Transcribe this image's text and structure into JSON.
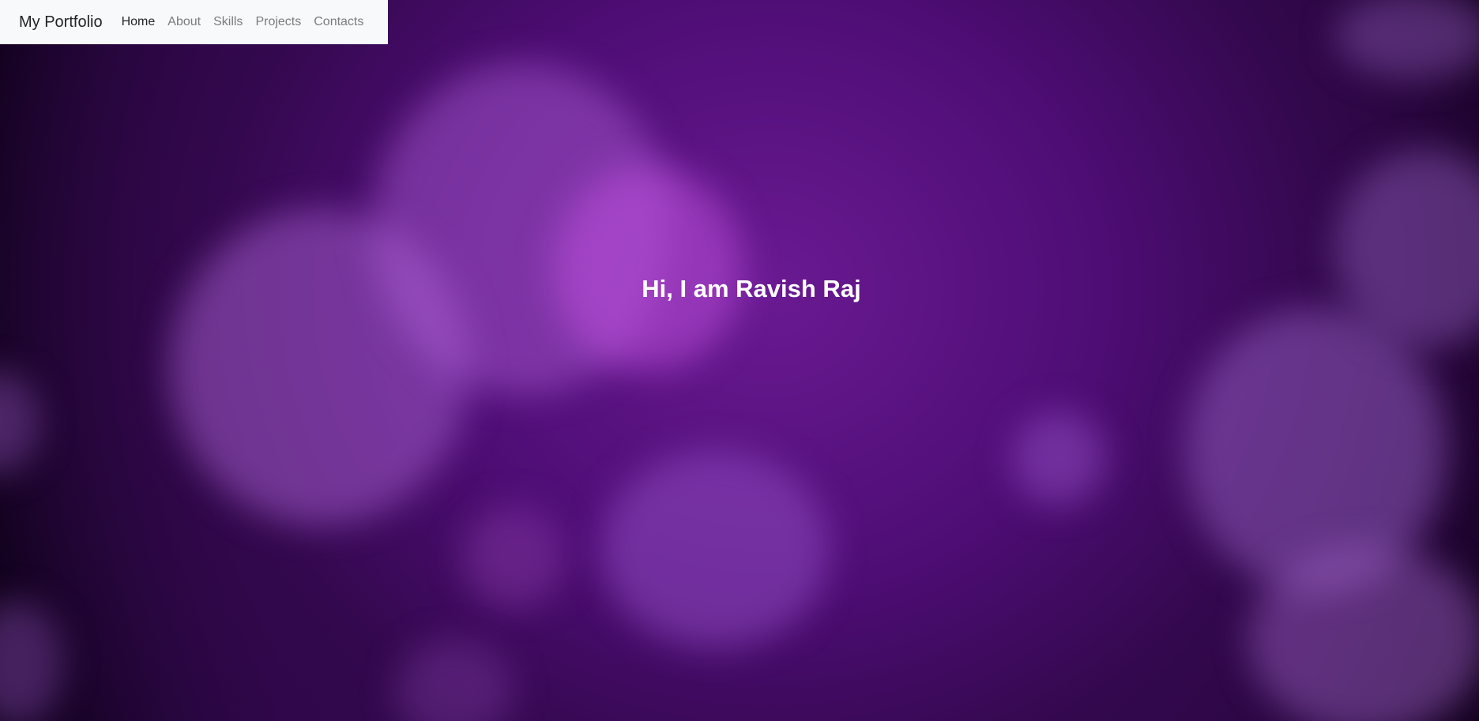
{
  "navbar": {
    "brand": "My Portfolio",
    "links": [
      {
        "label": "Home",
        "active": true
      },
      {
        "label": "About",
        "active": false
      },
      {
        "label": "Skills",
        "active": false
      },
      {
        "label": "Projects",
        "active": false
      },
      {
        "label": "Contacts",
        "active": false
      }
    ]
  },
  "hero": {
    "title": "Hi, I am Ravish Raj"
  },
  "colors": {
    "navbar_bg": "#f8f9fa",
    "nav_active": "#212529",
    "nav_inactive": "#7a7c80",
    "background": "#3a0a55",
    "hero_text": "#ffffff"
  }
}
